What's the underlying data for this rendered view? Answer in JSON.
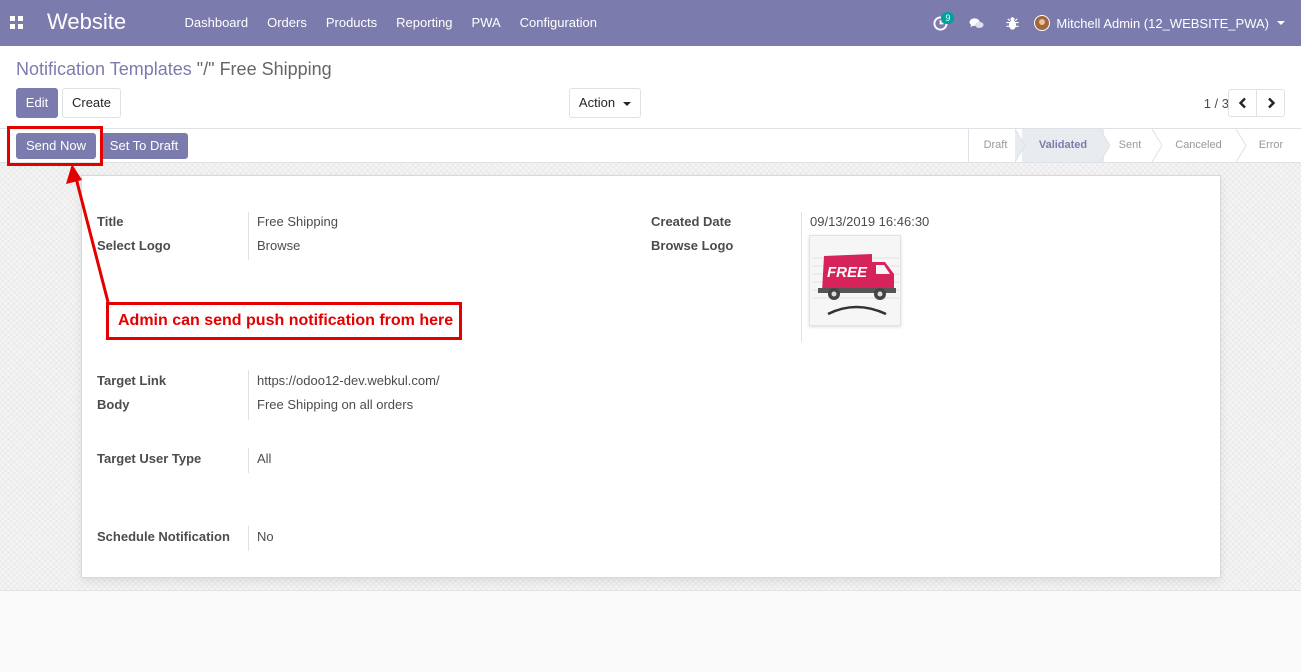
{
  "navbar": {
    "brand": "Website",
    "menu": [
      "Dashboard",
      "Orders",
      "Products",
      "Reporting",
      "PWA",
      "Configuration"
    ],
    "activity_count": "9",
    "user": "Mitchell Admin (12_WEBSITE_PWA)"
  },
  "breadcrumb": {
    "parent": "Notification Templates",
    "separator": " \"/\" ",
    "current": "Free Shipping"
  },
  "buttons": {
    "edit": "Edit",
    "create": "Create",
    "action": "Action",
    "send_now": "Send Now",
    "set_to_draft": "Set To Draft"
  },
  "pager": {
    "text": "1 / 3"
  },
  "statusbar": {
    "stages": [
      "Draft",
      "Validated",
      "Sent",
      "Canceled",
      "Error"
    ],
    "active": "Validated"
  },
  "form": {
    "title_label": "Title",
    "title_value": "Free Shipping",
    "select_logo_label": "Select Logo",
    "select_logo_value": "Browse",
    "created_date_label": "Created Date",
    "created_date_value": "09/13/2019 16:46:30",
    "browse_logo_label": "Browse Logo",
    "logo_text": "FREE",
    "target_link_label": "Target Link",
    "target_link_value": "https://odoo12-dev.webkul.com/",
    "body_label": "Body",
    "body_value": "Free Shipping on all orders",
    "target_user_type_label": "Target User Type",
    "target_user_type_value": "All",
    "schedule_label": "Schedule Notification",
    "schedule_value": "No"
  },
  "annotation": {
    "callout_text": "Admin can send push notification from here",
    "color": "#e30000"
  },
  "colors": {
    "brand": "#7c7bad",
    "badge": "#00a09d",
    "truck": "#d6245a"
  }
}
